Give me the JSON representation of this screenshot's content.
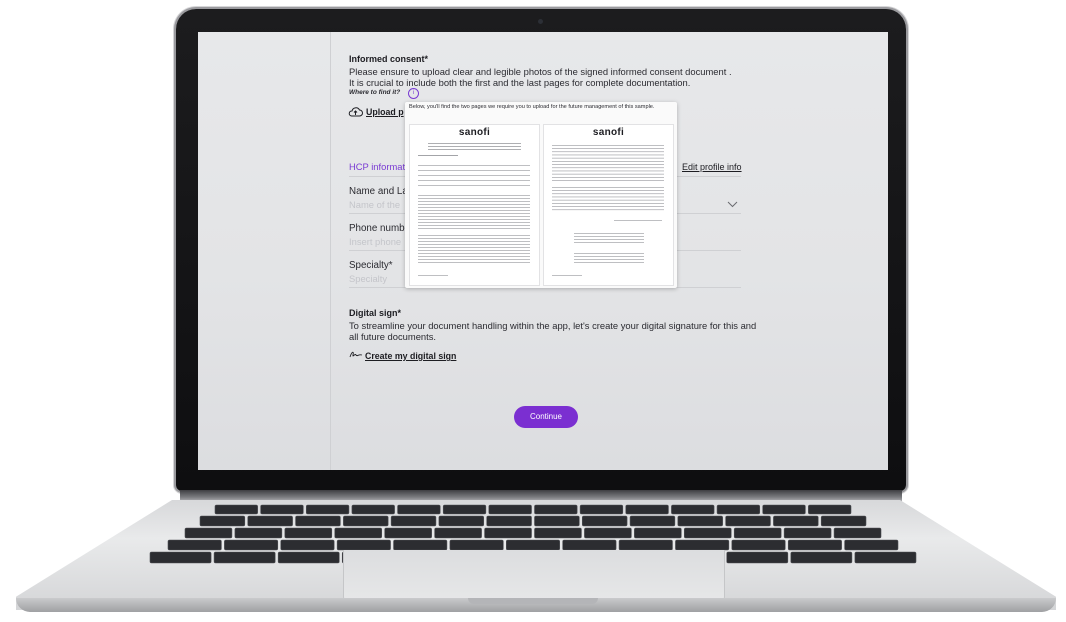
{
  "informed_consent": {
    "title": "Informed consent*",
    "line1": "Please ensure to upload clear and legible photos of the signed informed consent document .",
    "line2": "It is crucial to include both the first and the last pages for complete documentation.",
    "where_to_find": "Where to find it?",
    "info_icon_glyph": "i",
    "upload_label": "Upload p"
  },
  "tooltip": {
    "text": "Below, you'll find the two pages we require you to upload for the future management of this sample.",
    "brand": "sanofi"
  },
  "hcp": {
    "section_title": "HCP informat",
    "edit_link": "Edit profile info",
    "name_label": "Name and La",
    "name_placeholder": "Name of the",
    "phone_label": "Phone numbe",
    "phone_placeholder": "Insert phone",
    "specialty_label": "Specialty*",
    "specialty_placeholder": "Specialty"
  },
  "digital_sign": {
    "title": "Digital sign*",
    "line1": "To streamline your document handling within the app, let's create your digital signature for this and",
    "line2": "all future documents.",
    "link": "Create my digital sign"
  },
  "continue_label": "Continue",
  "colors": {
    "accent": "#7b2fd1",
    "hcp_title": "#7a3cd3",
    "text": "#1d1d22",
    "placeholder": "#c4c5ca"
  },
  "icons": {
    "upload": "cloud-upload-icon",
    "info": "info-icon",
    "sign": "signature-icon",
    "dropdown": "chevron-down-icon"
  }
}
